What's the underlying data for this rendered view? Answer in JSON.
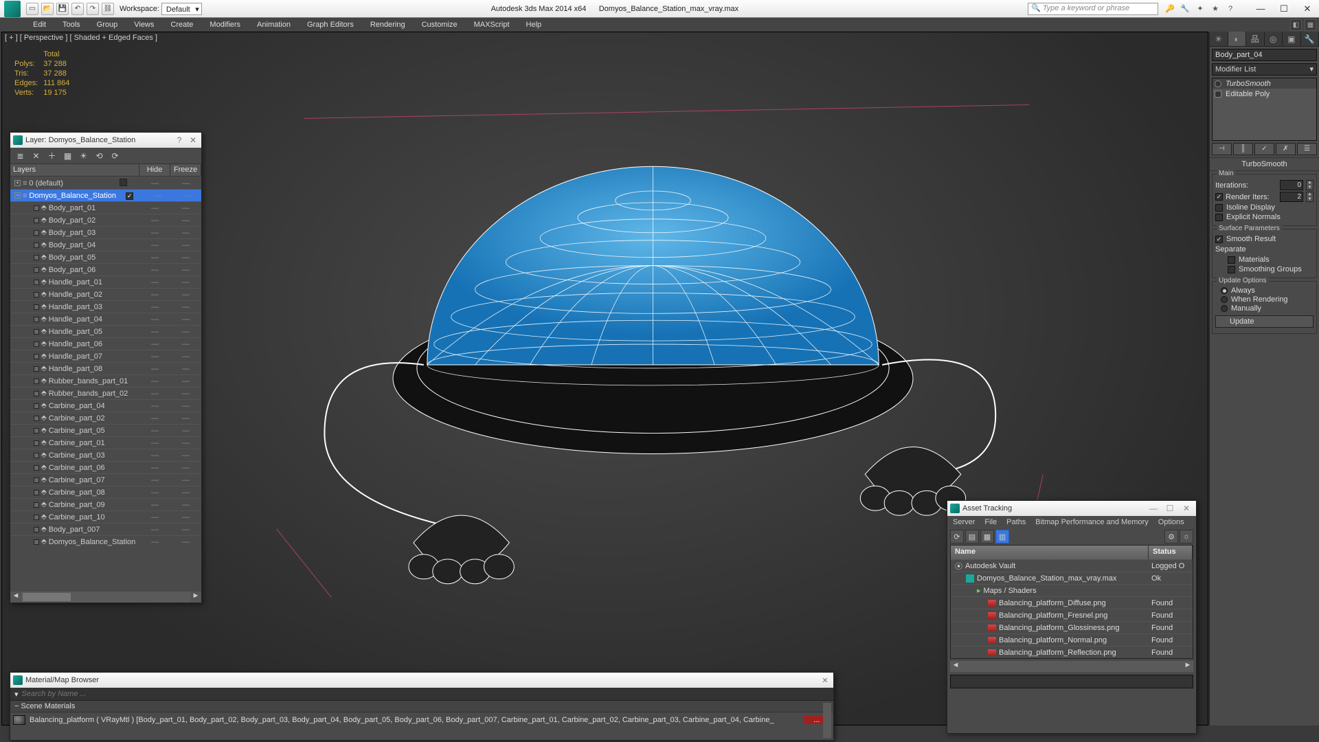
{
  "title": {
    "product": "Autodesk 3ds Max  2014 x64",
    "filename": "Domyos_Balance_Station_max_vray.max",
    "workspace_label": "Workspace:",
    "workspace_value": "Default",
    "search_placeholder": "Type a keyword or phrase"
  },
  "menus": [
    "Edit",
    "Tools",
    "Group",
    "Views",
    "Create",
    "Modifiers",
    "Animation",
    "Graph Editors",
    "Rendering",
    "Customize",
    "MAXScript",
    "Help"
  ],
  "viewport": {
    "label": "[ + ] [ Perspective ] [ Shaded + Edged Faces ]",
    "stats_header": "Total",
    "stats": [
      {
        "k": "Polys:",
        "v": "37 288"
      },
      {
        "k": "Tris:",
        "v": "37 288"
      },
      {
        "k": "Edges:",
        "v": "111 864"
      },
      {
        "k": "Verts:",
        "v": "19 175"
      }
    ]
  },
  "cmd": {
    "object_name": "Body_part_04",
    "modlist_label": "Modifier List",
    "stack": [
      {
        "name": "TurboSmooth",
        "italic": true
      },
      {
        "name": "Editable Poly",
        "italic": false
      }
    ],
    "rollout": "TurboSmooth",
    "group_main": "Main",
    "iterations_label": "Iterations:",
    "iterations_value": "0",
    "render_iters_label": "Render Iters:",
    "render_iters_value": "2",
    "isoline": "Isoline Display",
    "explicit": "Explicit Normals",
    "group_surf": "Surface Parameters",
    "smooth_result": "Smooth Result",
    "separate": "Separate",
    "sep_materials": "Materials",
    "sep_groups": "Smoothing Groups",
    "group_update": "Update Options",
    "upd_always": "Always",
    "upd_render": "When Rendering",
    "upd_manual": "Manually",
    "update_btn": "Update"
  },
  "layer": {
    "title": "Layer: Domyos_Balance_Station",
    "cols": {
      "c1": "Layers",
      "c2": "Hide",
      "c3": "Freeze"
    },
    "layer0": "0 (default)",
    "selected": "Domyos_Balance_Station",
    "items": [
      "Body_part_01",
      "Body_part_02",
      "Body_part_03",
      "Body_part_04",
      "Body_part_05",
      "Body_part_06",
      "Handle_part_01",
      "Handle_part_02",
      "Handle_part_03",
      "Handle_part_04",
      "Handle_part_05",
      "Handle_part_06",
      "Handle_part_07",
      "Handle_part_08",
      "Rubber_bands_part_01",
      "Rubber_bands_part_02",
      "Carbine_part_04",
      "Carbine_part_02",
      "Carbine_part_05",
      "Carbine_part_01",
      "Carbine_part_03",
      "Carbine_part_06",
      "Carbine_part_07",
      "Carbine_part_08",
      "Carbine_part_09",
      "Carbine_part_10",
      "Body_part_007",
      "Domyos_Balance_Station"
    ]
  },
  "asset": {
    "title": "Asset Tracking",
    "menus": [
      "Server",
      "File",
      "Paths",
      "Bitmap Performance and Memory",
      "Options"
    ],
    "cols": {
      "name": "Name",
      "status": "Status"
    },
    "rows": [
      {
        "indent": 0,
        "icon": "vault",
        "name": "Autodesk Vault",
        "status": "Logged O"
      },
      {
        "indent": 1,
        "icon": "max",
        "name": "Domyos_Balance_Station_max_vray.max",
        "status": "Ok"
      },
      {
        "indent": 2,
        "icon": "folder",
        "name": "Maps / Shaders",
        "status": ""
      },
      {
        "indent": 3,
        "icon": "img",
        "name": "Balancing_platform_Diffuse.png",
        "status": "Found"
      },
      {
        "indent": 3,
        "icon": "img",
        "name": "Balancing_platform_Fresnel.png",
        "status": "Found"
      },
      {
        "indent": 3,
        "icon": "img",
        "name": "Balancing_platform_Glossiness.png",
        "status": "Found"
      },
      {
        "indent": 3,
        "icon": "img",
        "name": "Balancing_platform_Normal.png",
        "status": "Found"
      },
      {
        "indent": 3,
        "icon": "img",
        "name": "Balancing_platform_Reflection.png",
        "status": "Found"
      }
    ]
  },
  "mat": {
    "title": "Material/Map Browser",
    "search_placeholder": "Search by Name ...",
    "rollout": "Scene Materials",
    "item": "Balancing_platform ( VRayMtl ) [Body_part_01, Body_part_02, Body_part_03, Body_part_04, Body_part_05, Body_part_06, Body_part_007, Carbine_part_01, Carbine_part_02, Carbine_part_03, Carbine_part_04, Carbine_",
    "trunc": "..."
  }
}
